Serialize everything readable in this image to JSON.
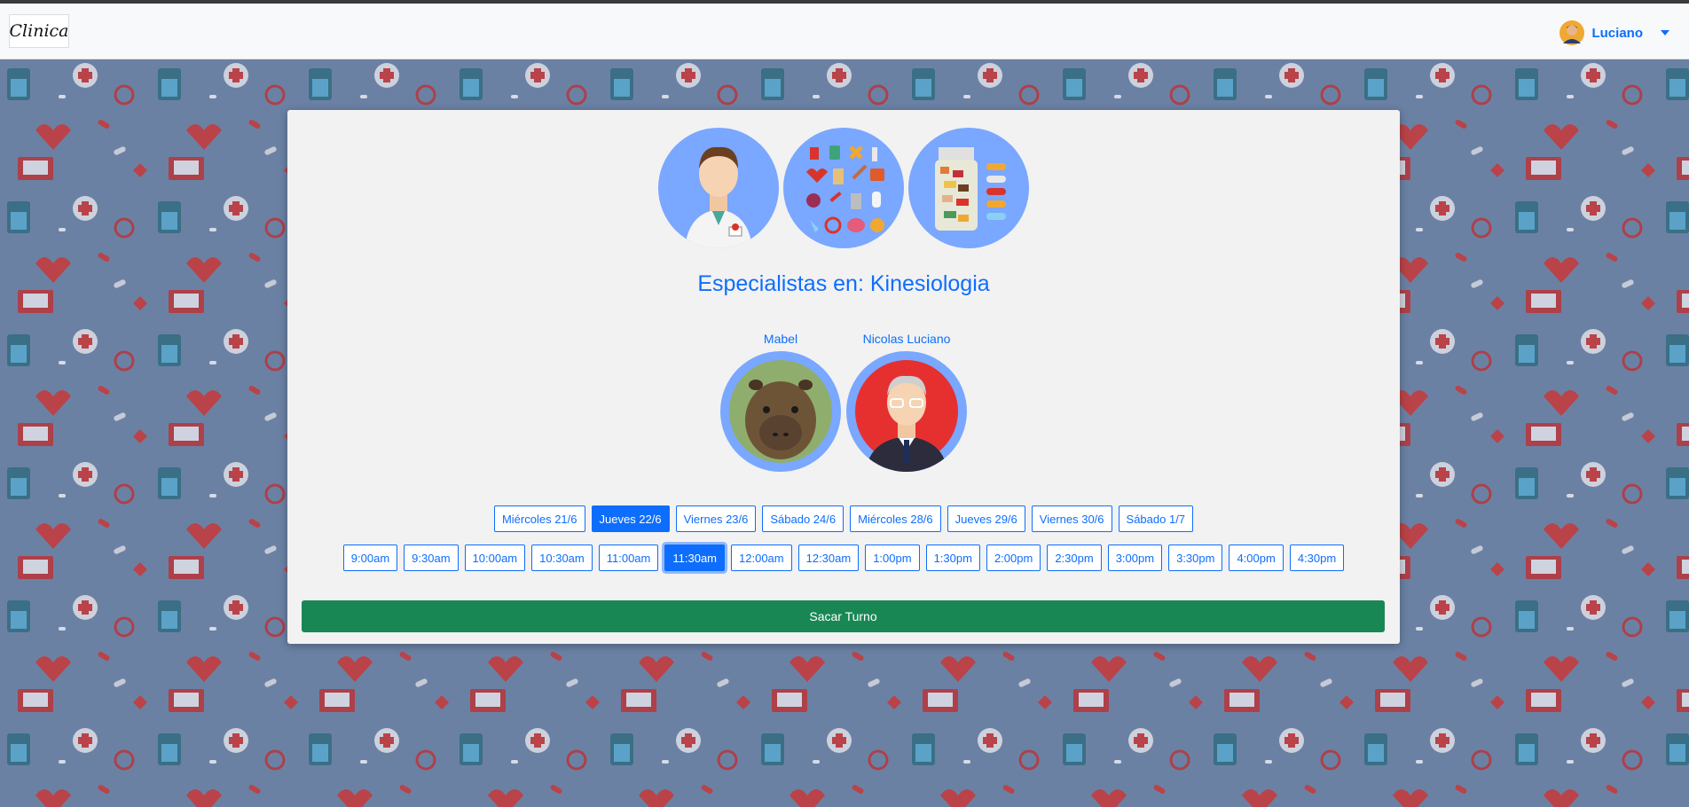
{
  "brand": {
    "logo_text": "Clinica"
  },
  "user": {
    "name": "Luciano"
  },
  "colors": {
    "primary": "#0d6efd",
    "success": "#198754",
    "icon_bg": "#7aa7ff"
  },
  "specialty_icons": [
    "doctor-icon",
    "medical-supplies-icon",
    "pill-bottle-icon"
  ],
  "title": "Especialistas en: Kinesiologia",
  "doctors": [
    {
      "name": "Mabel",
      "photo": "capybara-photo"
    },
    {
      "name": "Nicolas Luciano",
      "photo": "man-avatar"
    }
  ],
  "days": [
    "Miércoles 21/6",
    "Jueves 22/6",
    "Viernes 23/6",
    "Sábado 24/6",
    "Miércoles 28/6",
    "Jueves 29/6",
    "Viernes 30/6",
    "Sábado 1/7"
  ],
  "selected_day": "Jueves 22/6",
  "times": [
    "9:00am",
    "9:30am",
    "10:00am",
    "10:30am",
    "11:00am",
    "11:30am",
    "12:00am",
    "12:30am",
    "1:00pm",
    "1:30pm",
    "2:00pm",
    "2:30pm",
    "3:00pm",
    "3:30pm",
    "4:00pm",
    "4:30pm"
  ],
  "selected_time": "11:30am",
  "submit_label": "Sacar Turno"
}
